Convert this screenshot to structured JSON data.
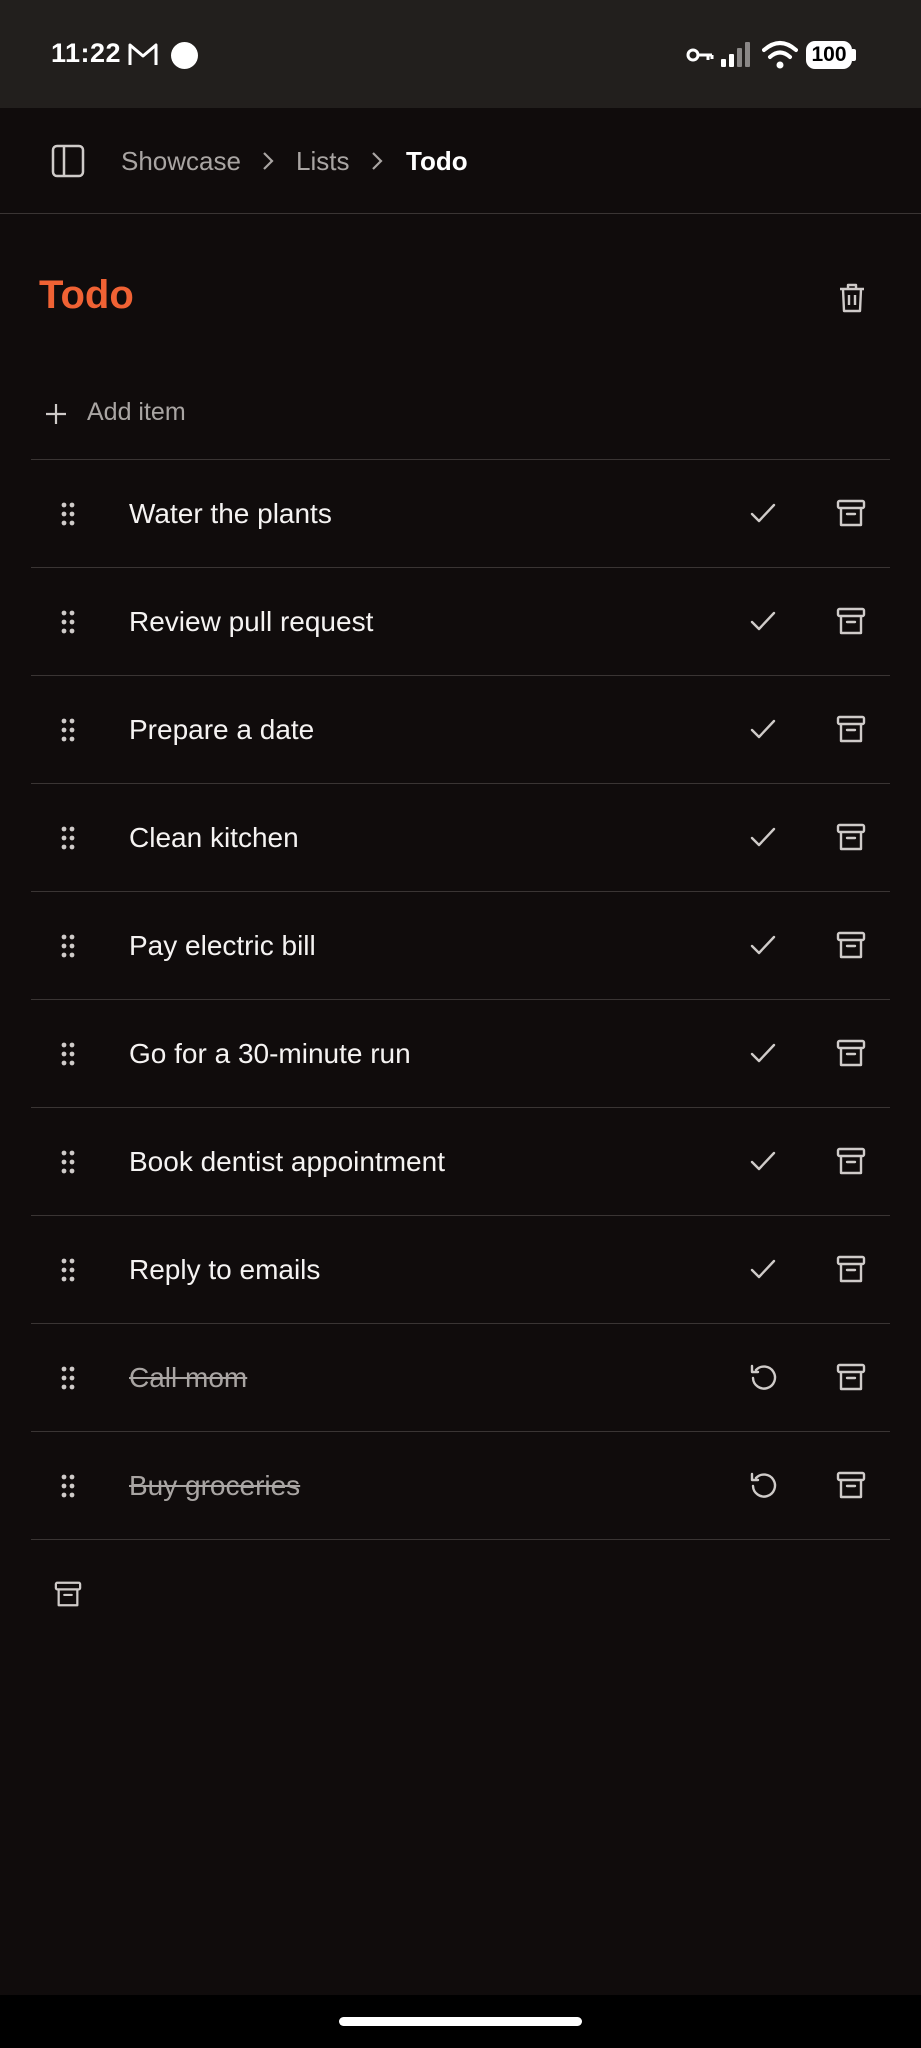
{
  "status_bar": {
    "time": "11:22",
    "battery": "100",
    "icons": [
      "gmail-icon",
      "notification-dot",
      "vpn-key-icon",
      "signal-icon",
      "wifi-icon",
      "battery-icon"
    ]
  },
  "breadcrumb": {
    "items": [
      "Showcase",
      "Lists",
      "Todo"
    ]
  },
  "page": {
    "title": "Todo",
    "add_label": "Add item"
  },
  "colors": {
    "accent": "#f06234",
    "background": "#100c0c",
    "status_bar": "#221f1d",
    "divider": "#3a3534",
    "muted_text": "#a9a5a3"
  },
  "todos": [
    {
      "text": "Water the plants",
      "done": false,
      "action_icon": "check-icon"
    },
    {
      "text": "Review pull request",
      "done": false,
      "action_icon": "check-icon"
    },
    {
      "text": "Prepare a date",
      "done": false,
      "action_icon": "check-icon"
    },
    {
      "text": "Clean kitchen",
      "done": false,
      "action_icon": "check-icon"
    },
    {
      "text": "Pay electric bill",
      "done": false,
      "action_icon": "check-icon"
    },
    {
      "text": "Go for a 30-minute run",
      "done": false,
      "action_icon": "check-icon"
    },
    {
      "text": "Book dentist appointment",
      "done": false,
      "action_icon": "check-icon"
    },
    {
      "text": "Reply to emails",
      "done": false,
      "action_icon": "check-icon"
    },
    {
      "text": "Call mom",
      "done": true,
      "action_icon": "undo-icon"
    },
    {
      "text": "Buy groceries",
      "done": true,
      "action_icon": "undo-icon"
    }
  ]
}
